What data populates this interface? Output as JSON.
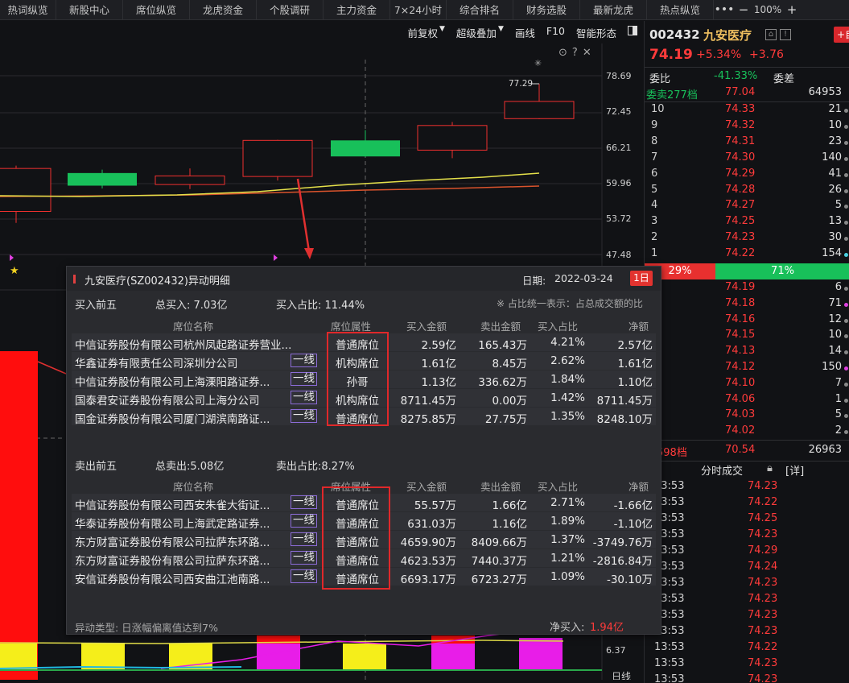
{
  "nav": {
    "tabs": [
      "热词纵览",
      "新股中心",
      "席位纵览",
      "龙虎资金",
      "个股调研",
      "主力资金",
      "7×24小时",
      "综合排名",
      "财务选股",
      "最新龙虎",
      "热点纵览"
    ],
    "more": "•••",
    "zoom_minus": "−",
    "zoom": "100%",
    "zoom_plus": "+"
  },
  "toolbar": {
    "adjust": "前复权",
    "overlay": "超级叠加",
    "draw": "画线",
    "f10": "F10",
    "smart": "智能形态"
  },
  "chart": {
    "price_axis": [
      "78.69",
      "72.45",
      "66.21",
      "59.96",
      "53.72",
      "47.48"
    ],
    "max_label": "77.29",
    "volume_axis": "6.37",
    "period_label": "日线",
    "candles": [
      {
        "open": 55.0,
        "high": 63.0,
        "low": 53.0,
        "close": 62.5,
        "color": "red"
      },
      {
        "open": 59.5,
        "high": 62.3,
        "low": 59.0,
        "close": 61.7,
        "color": "green"
      },
      {
        "open": 59.7,
        "high": 62.5,
        "low": 58.9,
        "close": 61.2,
        "color": "red"
      },
      {
        "open": 61.1,
        "high": 67.5,
        "low": 60.4,
        "close": 67.4,
        "color": "red"
      },
      {
        "open": 67.4,
        "high": 69.2,
        "low": 64.5,
        "close": 64.6,
        "color": "green"
      },
      {
        "open": 65.7,
        "high": 70.6,
        "low": 64.3,
        "close": 70.0,
        "color": "red"
      },
      {
        "open": 71.2,
        "high": 77.3,
        "low": 71.1,
        "close": 74.2,
        "color": "red"
      }
    ]
  },
  "quote": {
    "code": "002432",
    "name": "九安医疗",
    "price": "74.19",
    "pct": "+5.34%",
    "change": "+3.76",
    "add_label": "+自",
    "weibi_label": "委比",
    "weibi": "-41.33%",
    "weicha_label": "委差",
    "sell_total_label": "委卖277档",
    "sell_total_price": "77.04",
    "sell_total_vol": "64953",
    "asks": [
      {
        "lv": "10",
        "px": "74.33",
        "vol": "21"
      },
      {
        "lv": "9",
        "px": "74.32",
        "vol": "10"
      },
      {
        "lv": "8",
        "px": "74.31",
        "vol": "23"
      },
      {
        "lv": "7",
        "px": "74.30",
        "vol": "140"
      },
      {
        "lv": "6",
        "px": "74.29",
        "vol": "41"
      },
      {
        "lv": "5",
        "px": "74.28",
        "vol": "26"
      },
      {
        "lv": "4",
        "px": "74.27",
        "vol": "5"
      },
      {
        "lv": "3",
        "px": "74.25",
        "vol": "13"
      },
      {
        "lv": "2",
        "px": "74.23",
        "vol": "30"
      },
      {
        "lv": "1",
        "px": "74.22",
        "vol": "154"
      }
    ],
    "ratio_buy": "29%",
    "ratio_sell": "71%",
    "bids": [
      {
        "px": "74.19",
        "vol": "6"
      },
      {
        "px": "74.18",
        "vol": "71"
      },
      {
        "px": "74.16",
        "vol": "12"
      },
      {
        "px": "74.15",
        "vol": "10"
      },
      {
        "px": "74.13",
        "vol": "14"
      },
      {
        "px": "74.12",
        "vol": "150"
      },
      {
        "px": "74.10",
        "vol": "7"
      },
      {
        "px": "74.06",
        "vol": "1"
      },
      {
        "px": "74.03",
        "vol": "5"
      },
      {
        "px": "74.02",
        "vol": "2"
      }
    ],
    "buy_total_label": "买598档",
    "buy_total_price": "70.54",
    "buy_total_vol": "26963",
    "ticks_title": "分时成交",
    "ticks_detail": "[详]",
    "ticks": [
      {
        "t": "13:53",
        "p": "74.23"
      },
      {
        "t": "13:53",
        "p": "74.22"
      },
      {
        "t": "13:53",
        "p": "74.25"
      },
      {
        "t": "13:53",
        "p": "74.23"
      },
      {
        "t": "13:53",
        "p": "74.29"
      },
      {
        "t": "13:53",
        "p": "74.24"
      },
      {
        "t": "13:53",
        "p": "74.23"
      },
      {
        "t": "13:53",
        "p": "74.23"
      },
      {
        "t": "13:53",
        "p": "74.23"
      },
      {
        "t": "13:53",
        "p": "74.23"
      },
      {
        "t": "13:53",
        "p": "74.22"
      },
      {
        "t": "13:53",
        "p": "74.23"
      },
      {
        "t": "13:53",
        "p": "74.23"
      }
    ]
  },
  "popup": {
    "title": "九安医疗(SZ002432)异动明细",
    "date_label": "日期:",
    "date": "2022-03-24",
    "period_btn": "1日",
    "buy_section": "买入前五",
    "buy_total": "总买入: 7.03亿",
    "buy_ratio": "买入占比: 11.44%",
    "note": "※ 占比统一表示：占总成交额的比",
    "headers": [
      "席位名称",
      "席位属性",
      "买入金额",
      "卖出金额",
      "买入占比",
      "净额"
    ],
    "buy_rows": [
      {
        "name": "中信证券股份有限公司杭州凤起路证券营业...",
        "tag": "",
        "attr": "普通席位",
        "buy": "2.59亿",
        "sell": "165.43万",
        "ratio": "4.21%",
        "net": "2.57亿"
      },
      {
        "name": "华鑫证券有限责任公司深圳分公司",
        "tag": "一线",
        "attr": "机构席位",
        "buy": "1.61亿",
        "sell": "8.45万",
        "ratio": "2.62%",
        "net": "1.61亿"
      },
      {
        "name": "中信证券股份有限公司上海溧阳路证券...",
        "tag": "一线",
        "attr": "孙哥",
        "buy": "1.13亿",
        "sell": "336.62万",
        "ratio": "1.84%",
        "net": "1.10亿"
      },
      {
        "name": "国泰君安证券股份有限公司上海分公司",
        "tag": "一线",
        "attr": "机构席位",
        "buy": "8711.45万",
        "sell": "0.00万",
        "ratio": "1.42%",
        "net": "8711.45万"
      },
      {
        "name": "国金证券股份有限公司厦门湖滨南路证...",
        "tag": "一线",
        "attr": "普通席位",
        "buy": "8275.85万",
        "sell": "27.75万",
        "ratio": "1.35%",
        "net": "8248.10万"
      }
    ],
    "sell_section": "卖出前五",
    "sell_total": "总卖出:5.08亿",
    "sell_ratio": "卖出占比:8.27%",
    "sell_headers": [
      "席位名称",
      "席位属性",
      "买入金额",
      "卖出金额",
      "买入占比",
      "净额"
    ],
    "sell_rows": [
      {
        "name": "中信证券股份有限公司西安朱雀大街证...",
        "tag": "一线",
        "attr": "普通席位",
        "buy": "55.57万",
        "sell": "1.66亿",
        "ratio": "2.71%",
        "net": "-1.66亿"
      },
      {
        "name": "华泰证券股份有限公司上海武定路证券...",
        "tag": "一线",
        "attr": "普通席位",
        "buy": "631.03万",
        "sell": "1.16亿",
        "ratio": "1.89%",
        "net": "-1.10亿"
      },
      {
        "name": "东方财富证券股份有限公司拉萨东环路...",
        "tag": "一线",
        "attr": "普通席位",
        "buy": "4659.90万",
        "sell": "8409.66万",
        "ratio": "1.37%",
        "net": "-3749.76万"
      },
      {
        "name": "东方财富证券股份有限公司拉萨东环路...",
        "tag": "一线",
        "attr": "普通席位",
        "buy": "4623.53万",
        "sell": "7440.37万",
        "ratio": "1.21%",
        "net": "-2816.84万"
      },
      {
        "name": "安信证券股份有限公司西安曲江池南路...",
        "tag": "一线",
        "attr": "普通席位",
        "buy": "6693.17万",
        "sell": "6723.27万",
        "ratio": "1.09%",
        "net": "-30.10万"
      }
    ],
    "type_label": "异动类型: 日涨幅偏离值达到7%",
    "net_label": "净买入:",
    "net_value": "1.94亿"
  }
}
